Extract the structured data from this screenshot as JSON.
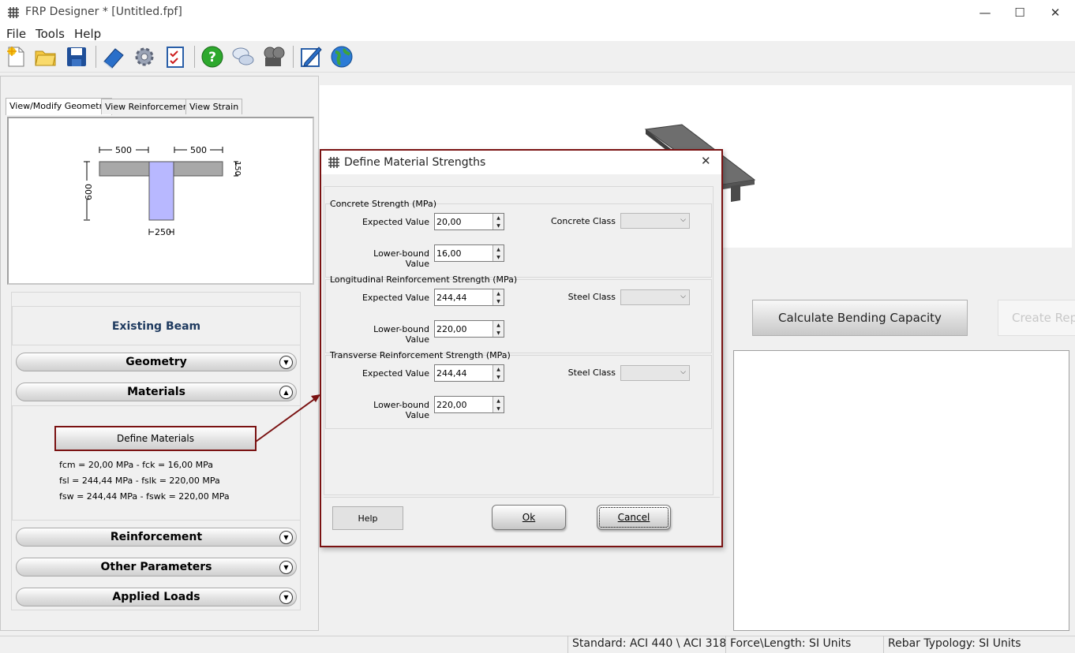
{
  "window": {
    "title": "FRP Designer * [Untitled.fpf]",
    "controls": {
      "minimize": "—",
      "maximize": "☐",
      "close": "✕"
    }
  },
  "menu": [
    "File",
    "Tools",
    "Help"
  ],
  "toolbar": {
    "icons": [
      "new-file-icon",
      "open-folder-icon",
      "save-icon",
      "book-icon",
      "gear-icon",
      "checklist-icon",
      "help-icon",
      "chat-icon",
      "film-icon",
      "edit-icon",
      "globe-icon"
    ]
  },
  "tabs": [
    "View/Modify Geometry",
    "View Reinforcement",
    "View Strain"
  ],
  "geometry": {
    "flange_left": "500",
    "flange_right": "500",
    "height": "600",
    "flange_thickness": "150",
    "web_width": "250"
  },
  "beam_panel": {
    "title": "Existing Beam",
    "sections": [
      "Geometry",
      "Materials",
      "Reinforcement",
      "Other Parameters",
      "Applied Loads"
    ],
    "define_materials": "Define Materials",
    "material_lines": [
      "fcm = 20,00 MPa   -   fck = 16,00 MPa",
      "fsl = 244,44 MPa   -   fslk = 220,00 MPa",
      "fsw = 244,44 MPa   -   fswk = 220,00 MPa"
    ]
  },
  "right_panel": {
    "calculate": "Calculate Bending Capacity",
    "create_report": "Create Rep"
  },
  "status_bar": {
    "standard": "Standard: ACI 440 \\ ACI 318",
    "force_length": "Force\\Length: SI Units",
    "rebar": "Rebar Typology: SI Units"
  },
  "dialog": {
    "title": "Define Material Strengths",
    "groups": [
      {
        "title": "Concrete Strength (MPa)",
        "expected_label": "Expected Value",
        "expected": "20,00",
        "lower_label": "Lower-bound Value",
        "lower": "16,00",
        "class_label": "Concrete Class"
      },
      {
        "title": "Longitudinal Reinforcement Strength (MPa)",
        "expected_label": "Expected Value",
        "expected": "244,44",
        "lower_label": "Lower-bound Value",
        "lower": "220,00",
        "class_label": "Steel Class"
      },
      {
        "title": "Transverse Reinforcement Strength (MPa)",
        "expected_label": "Expected Value",
        "expected": "244,44",
        "lower_label": "Lower-bound Value",
        "lower": "220,00",
        "class_label": "Steel Class"
      }
    ],
    "help": "Help",
    "ok": "Ok",
    "cancel": "Cancel"
  },
  "colors": {
    "highlight_border": "#7a1212",
    "web_fill": "#b8b8ff",
    "flange_fill": "#a8a8a8",
    "existing_beam_title": "#1e3a5f"
  }
}
